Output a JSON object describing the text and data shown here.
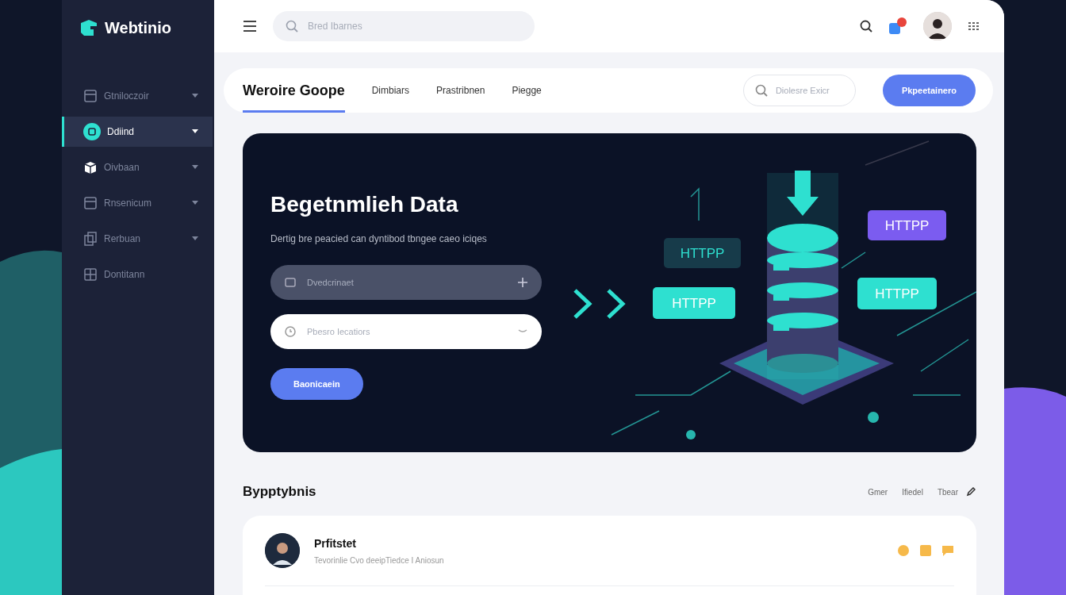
{
  "sidebar": {
    "logo": "Webtinio",
    "items": [
      {
        "label": "Gtniloczoir",
        "kind": "window",
        "selected": false,
        "caret": true
      },
      {
        "label": "Ddiind",
        "kind": "circle",
        "selected": true,
        "caret": true
      },
      {
        "label": "Oivbaan",
        "kind": "box",
        "selected": false,
        "caret": true
      },
      {
        "label": "Rnsenicum",
        "kind": "window",
        "selected": false,
        "caret": true
      },
      {
        "label": "Rerbuan",
        "kind": "pages",
        "selected": false,
        "caret": true
      },
      {
        "label": "Dontitann",
        "kind": "grid",
        "selected": false,
        "caret": false
      }
    ]
  },
  "header": {
    "search": {
      "placeholder": "Bred Ibarnes"
    },
    "notifications": {
      "unread": true
    }
  },
  "page_bar": {
    "tabs": [
      {
        "label": "Weroire Goope",
        "selected": true
      },
      {
        "label": "Dimbiars",
        "selected": false
      },
      {
        "label": "Prastribnen",
        "selected": false
      },
      {
        "label": "Piegge",
        "selected": false
      }
    ],
    "search": {
      "placeholder": "Diolesre Exicr"
    },
    "button": "Pkpeetainero"
  },
  "hero": {
    "title": "Begetnmlieh Data",
    "subtitle": "Dertig bre peacied can dyntibod tbngee caeo iciqes",
    "fields": [
      {
        "kind": "add",
        "placeholder": "Dvedcrinaet"
      },
      {
        "kind": "select",
        "placeholder": "Pbesro Iecatiors"
      }
    ],
    "button": "Baonicaein",
    "tags": [
      {
        "label": "HTTPP",
        "color": "#7b5cf0"
      },
      {
        "label": "HTTPP",
        "color": "#173b4a"
      },
      {
        "label": "HTTPP",
        "color": "#2ee0d0"
      },
      {
        "label": "HTTPP",
        "color": "#2ee0d0"
      }
    ]
  },
  "section": {
    "title": "Bypptybnis",
    "links": [
      "Gmer",
      "Ifiedel",
      "Tbear"
    ],
    "rows": [
      {
        "name": "Prfitstet",
        "detail": "Tevorinlie Cvo deeipTiedce I Aniosun"
      }
    ]
  }
}
